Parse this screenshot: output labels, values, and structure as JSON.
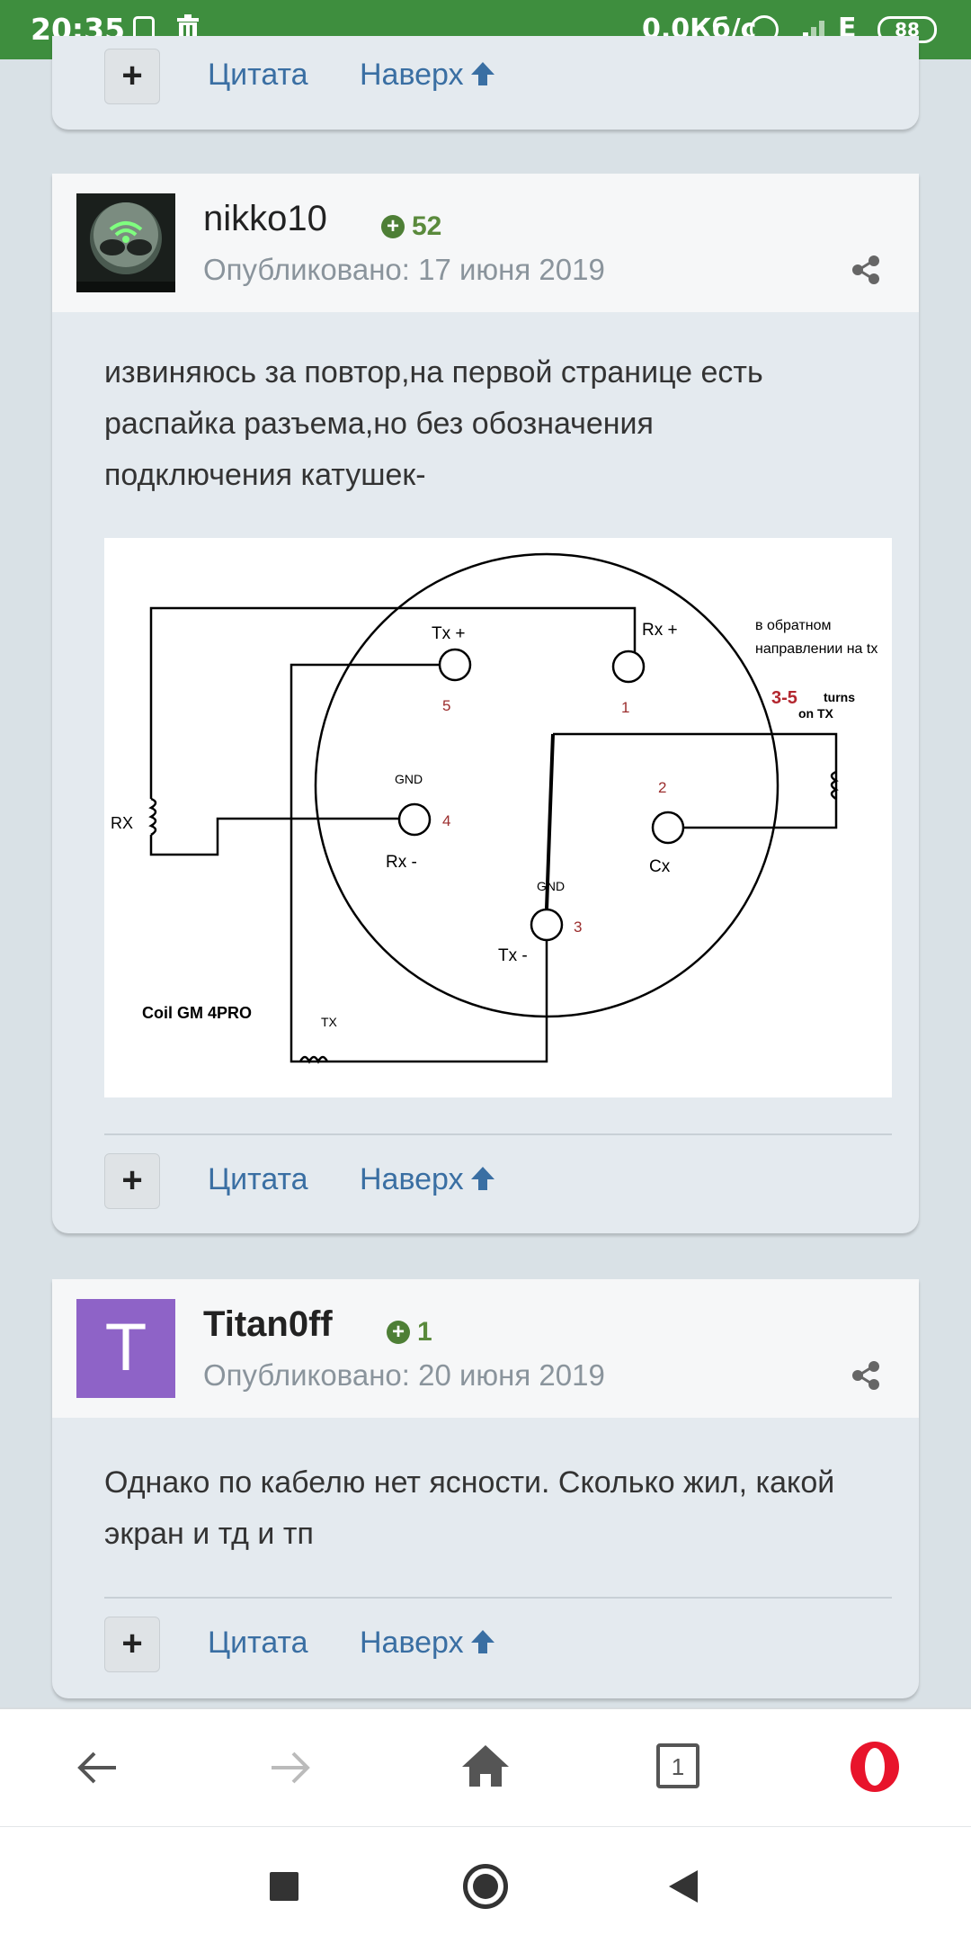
{
  "status_bar": {
    "time": "20:35",
    "speed": "0,0Кб/с",
    "network": "E",
    "battery": "88"
  },
  "actions": {
    "plus": "+",
    "quote": "Цитата",
    "top": "Наверх"
  },
  "posts": [
    {
      "author": "nikko10",
      "reputation": "52",
      "published": "Опубликовано: 17 июня 2019",
      "text_lines": [
        "извиняюсь за повтор,на первой странице есть",
        "распайка разъема,но без обозначения",
        "подключения катушек-"
      ],
      "diagram": {
        "tx_plus": "Tx +",
        "rx_plus": "Rx +",
        "note_line1": "в обратном",
        "note_line2": "направлении на tx",
        "turns_num": "3-5",
        "turns_word": "turns",
        "on_tx": "on TX",
        "pin5": "5",
        "pin1": "1",
        "pin2": "2",
        "pin4": "4",
        "pin3": "3",
        "gnd_left": "GND",
        "gnd_bottom": "GND",
        "rx_label": "RX",
        "rx_minus": "Rx -",
        "cx": "Cx",
        "tx_minus": "Tx -",
        "coil_label": "Coil  GM 4PRO",
        "tx_label": "TX"
      }
    },
    {
      "author": "Titan0ff",
      "avatar_letter": "T",
      "reputation": "1",
      "published": "Опубликовано: 20 июня 2019",
      "text_lines": [
        "Однако по кабелю нет ясности. Сколько жил, какой",
        "экран и тд и тп"
      ]
    }
  ],
  "colors": {
    "status_bar": "#3e8e3e",
    "link": "#3a6fa3",
    "reputation": "#5a8a3c",
    "avatar_purple": "#8e63c7",
    "opera_red": "#e8142b"
  },
  "icons": [
    "nfc-icon",
    "trash-icon",
    "alarm-icon",
    "signal-icon",
    "share-icon",
    "up-arrow-icon",
    "back-arrow-icon",
    "forward-arrow-icon",
    "home-icon",
    "tabs-icon",
    "opera-icon",
    "recent-apps-icon",
    "home-circle-icon",
    "back-triangle-icon"
  ],
  "nav": {
    "tabs_count": "1"
  }
}
